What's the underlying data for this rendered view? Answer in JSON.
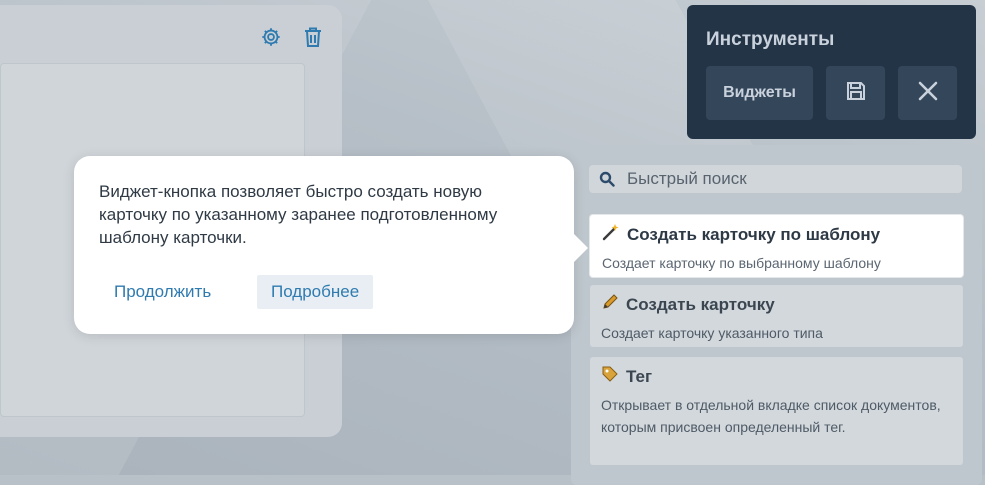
{
  "widget_card": {
    "icons": [
      "gear-icon",
      "trash-icon"
    ]
  },
  "tools": {
    "title": "Инструменты",
    "widgets_label": "Виджеты",
    "save_icon": "floppy-disk-icon",
    "close_icon": "close-icon"
  },
  "search": {
    "placeholder": "Быстрый поиск",
    "icon": "search-icon"
  },
  "items": [
    {
      "icon": "magic-wand-icon",
      "title": "Создать карточку по шаблону",
      "desc": "Создает карточку по выбранному шаблону"
    },
    {
      "icon": "pencil-icon",
      "title": "Создать карточку",
      "desc": "Создает карточку указанного типа"
    },
    {
      "icon": "tag-icon",
      "title": "Тег",
      "desc": "Открывает в отдельной вкладке список документов, которым присвоен определенный тег."
    }
  ],
  "tooltip": {
    "text": "Виджет-кнопка позволяет быстро создать новую карточку по указанному заранее подготовленному шаблону карточки.",
    "continue_label": "Продолжить",
    "details_label": "Подробнее"
  },
  "colors": {
    "tools_bg": "#243447",
    "link": "#2f7bb0",
    "accent_icon": "#2f7bb0"
  }
}
